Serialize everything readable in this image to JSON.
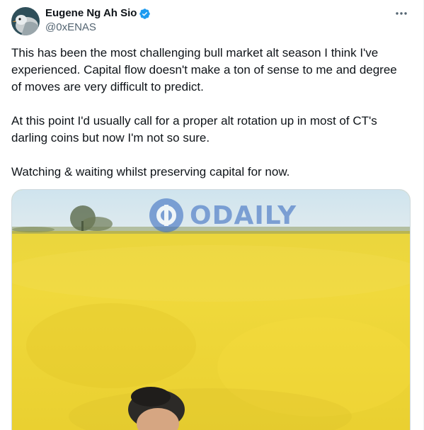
{
  "author": {
    "name": "Eugene Ng Ah Sio",
    "handle": "@0xENAS",
    "verified": true
  },
  "tweet": {
    "paragraphs": [
      "This has been the most challenging bull market alt season I think I've experienced. Capital flow doesn't make a ton of sense to me and degree of moves are very difficult to predict.",
      "At this point I'd usually call for a proper alt rotation up in most of CT's darling coins but now I'm not so sure.",
      "Watching & waiting whilst preserving capital for now."
    ]
  },
  "media": {
    "watermark_text": "ODAILY"
  },
  "icons": {
    "verified": "verified-badge-icon",
    "more": "more-options-icon"
  },
  "colors": {
    "verified_blue": "#1d9bf0",
    "handle_gray": "#536471",
    "watermark_blue": "#3d6fc2"
  }
}
